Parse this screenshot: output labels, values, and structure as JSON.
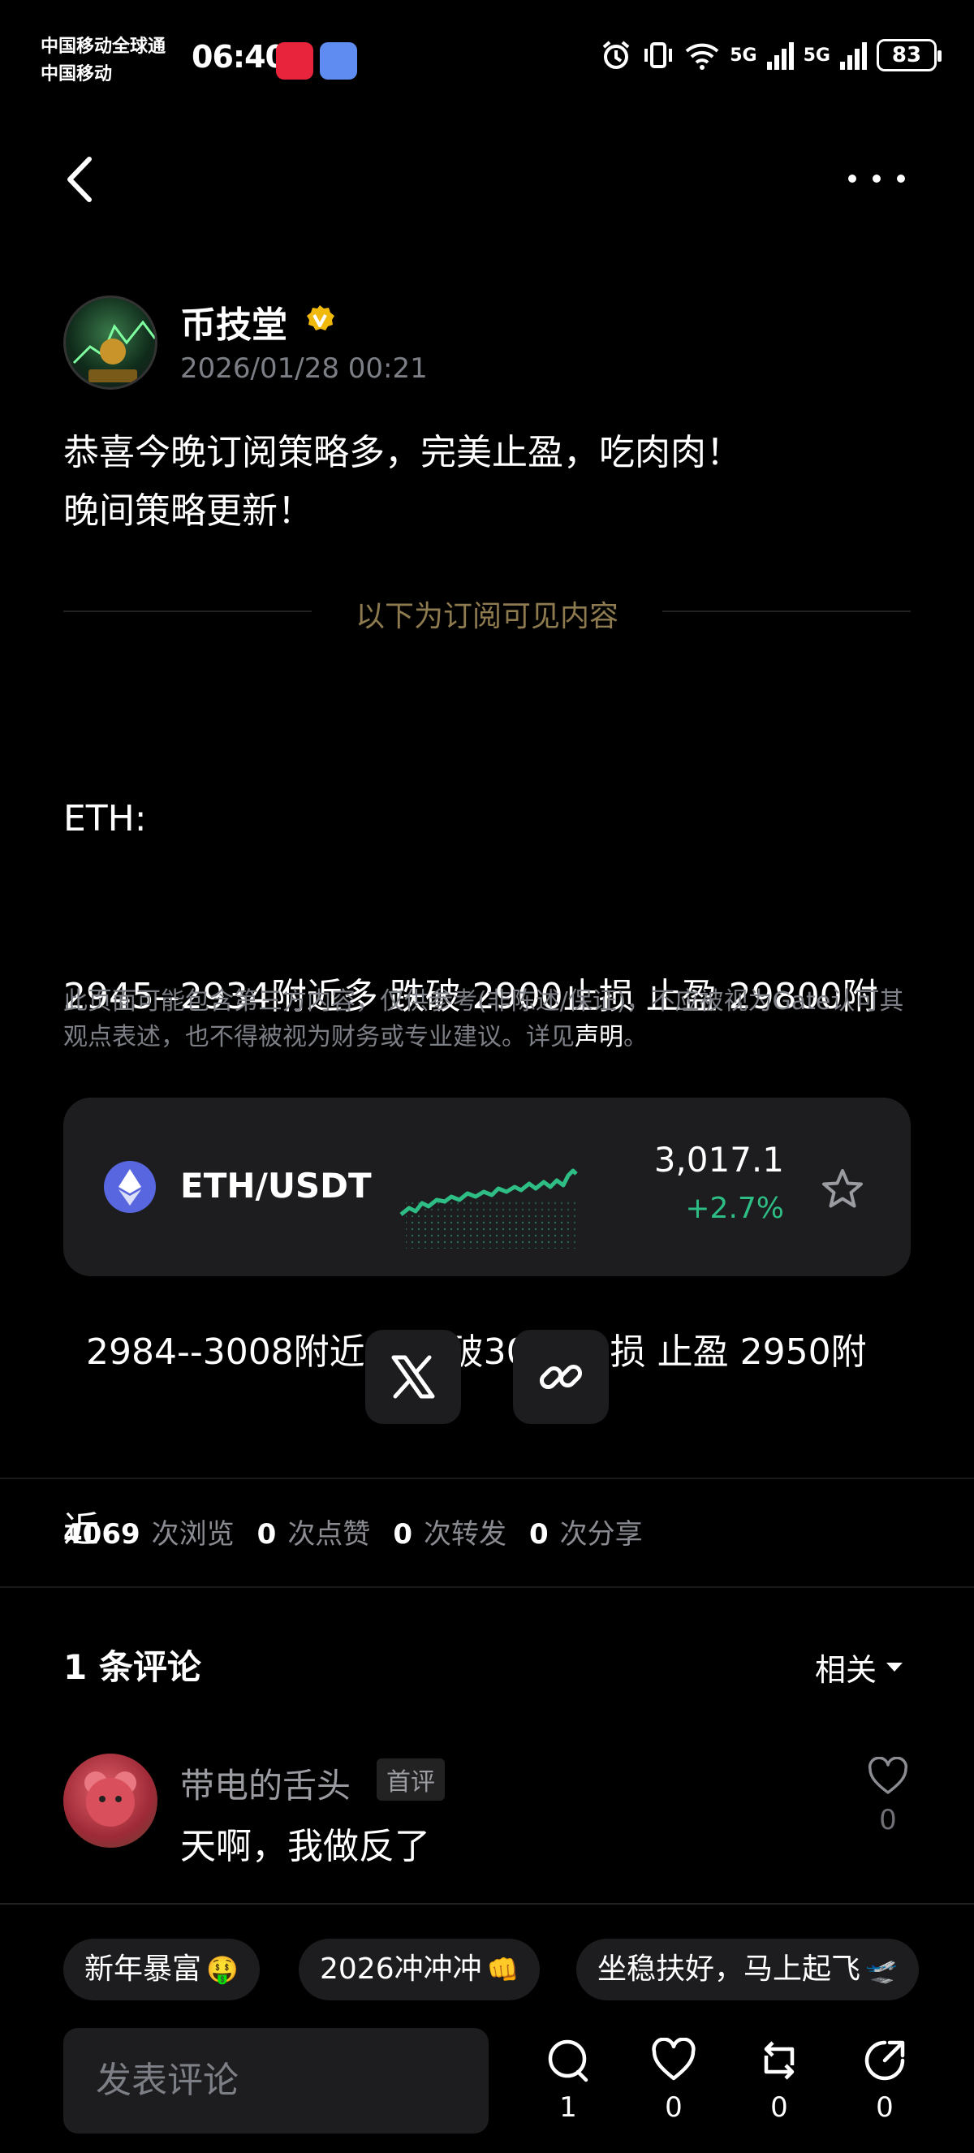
{
  "status_bar": {
    "carrier_1": "中国移动全球通",
    "carrier_2": "中国移动",
    "time": "06:40",
    "net_1": "5G",
    "net_2": "5G",
    "battery": "83"
  },
  "post": {
    "author": "币技堂",
    "date": "2026/01/28 00:21",
    "intro_line_1": "恭喜今晚订阅策略多，完美止盈，吃肉肉！",
    "intro_line_2": "晚间策略更新！",
    "subscriber_label": "以下为订阅可见内容",
    "strategy_lines": [
      "ETH:",
      "2945--2934附近多 跌破 2900止损 止盈 29800附",
      "近",
      "  2984--3008附近空 突破3030止损 止盈 2950附",
      "近"
    ],
    "disclaimer_text": "此页面可能包含第三方内容，仅供参考(非陈述/保证)，不应被视为Gate认可其观点表述，也不得被视为财务或专业建议。详见",
    "disclaimer_link": "声明",
    "disclaimer_end": "。"
  },
  "ticker": {
    "pair": "ETH/USDT",
    "price": "3,017.1",
    "change": "+2.7%",
    "trend_color": "#2dbd85",
    "icon": "ethereum-icon"
  },
  "stats": [
    {
      "value": "4069",
      "label": "次浏览"
    },
    {
      "value": "0",
      "label": "次点赞"
    },
    {
      "value": "0",
      "label": "次转发"
    },
    {
      "value": "0",
      "label": "次分享"
    }
  ],
  "comments": {
    "title": "1 条评论",
    "sort_label": "相关",
    "items": [
      {
        "user": "带电的舌头",
        "tag": "首评",
        "text": "天啊，我做反了",
        "likes": "0"
      }
    ]
  },
  "bottom": {
    "chips": [
      {
        "text": "新年暴富",
        "emoji": "🤑"
      },
      {
        "text": "2026冲冲冲",
        "emoji": "👊"
      },
      {
        "text": "坐稳扶好，马上起飞",
        "emoji": "🛫"
      }
    ],
    "input_placeholder": "发表评论",
    "actions": {
      "comment": "1",
      "like": "0",
      "repost": "0",
      "share": "0"
    }
  },
  "colors": {
    "background": "#000000",
    "card": "#1d1d1f",
    "positive": "#2dbd85",
    "subscriber_label": "#8e7a4f",
    "verified_badge": "#f0b90b"
  }
}
